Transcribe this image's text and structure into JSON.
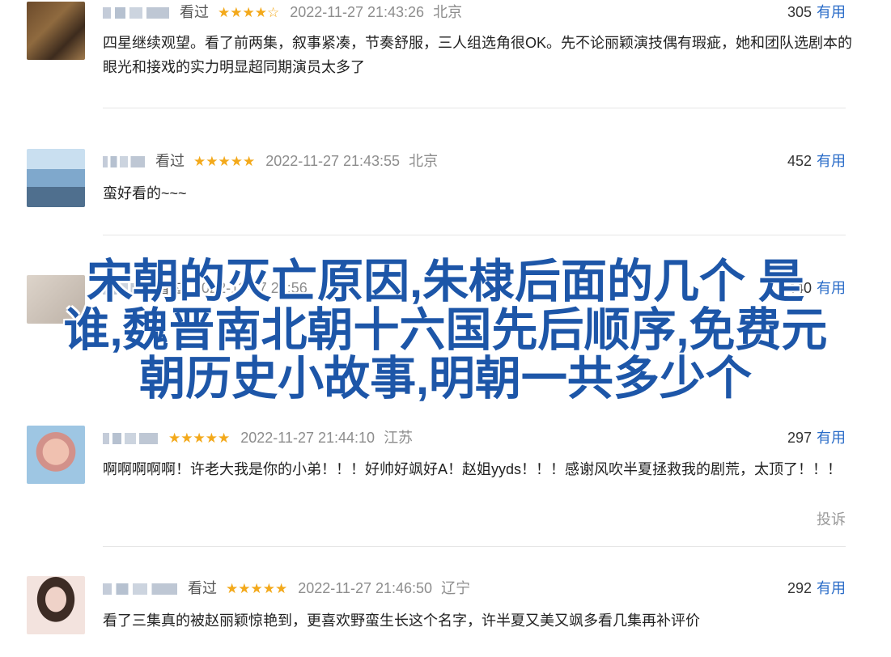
{
  "reviews": [
    {
      "seen": "看过",
      "stars": "★★★★☆",
      "time": "2022-11-27 21:43:26",
      "location": "北京",
      "useful_count": "305",
      "useful_label": "有用",
      "content": "四星继续观望。看了前两集，叙事紧凑，节奏舒服，三人组选角很OK。先不论丽颖演技偶有瑕疵，她和团队选剧本的眼光和接戏的实力明显超同期演员太多了",
      "avatar_colors": [
        "#5a3b22",
        "#7a5630",
        "#3b2a1c"
      ]
    },
    {
      "seen": "看过",
      "stars": "★★★★★",
      "time": "2022-11-27 21:43:55",
      "location": "北京",
      "useful_count": "452",
      "useful_label": "有用",
      "content": "蛮好看的~~~",
      "avatar_colors": [
        "#6d9cc6",
        "#9fc3de",
        "#3f5f7c"
      ]
    },
    {
      "seen": "看过",
      "stars": "★★★★★",
      "time": "2022-11-27 21:44:10",
      "location": "江苏",
      "useful_count": "297",
      "useful_label": "有用",
      "content": "啊啊啊啊啊！许老大我是你的小弟！！！好帅好飒好A！赵姐yyds！！！感谢风吹半夏拯救我的剧荒，太顶了！！！",
      "report": "投诉",
      "avatar_colors": [
        "#e8b7a3",
        "#d58d86",
        "#9bc2e0"
      ]
    },
    {
      "seen": "看过",
      "stars": "★★★★★",
      "time": "2022-11-27 21:46:50",
      "location": "辽宁",
      "useful_count": "292",
      "useful_label": "有用",
      "content": "看了三集真的被赵丽颖惊艳到，更喜欢野蛮生长这个名字，许半夏又美又飒多看几集再补评价",
      "avatar_colors": [
        "#f1dcd6",
        "#3a2a24",
        "#e9c7bd"
      ]
    }
  ],
  "partial_review": {
    "seen": "看过",
    "time": "2022-11-27 21:56",
    "useful_count": "440",
    "useful_label": "有用"
  },
  "overlay_title": {
    "line1": "宋朝的灭亡原因,朱棣后面的几个 是",
    "line2": "谁,魏晋南北朝十六国先后顺序,免费元",
    "line3": "朝历史小故事,明朝一共多少个"
  },
  "colors": {
    "link": "#2a6cc8",
    "star": "#f3a91b",
    "overlay": "#1d56a8"
  }
}
